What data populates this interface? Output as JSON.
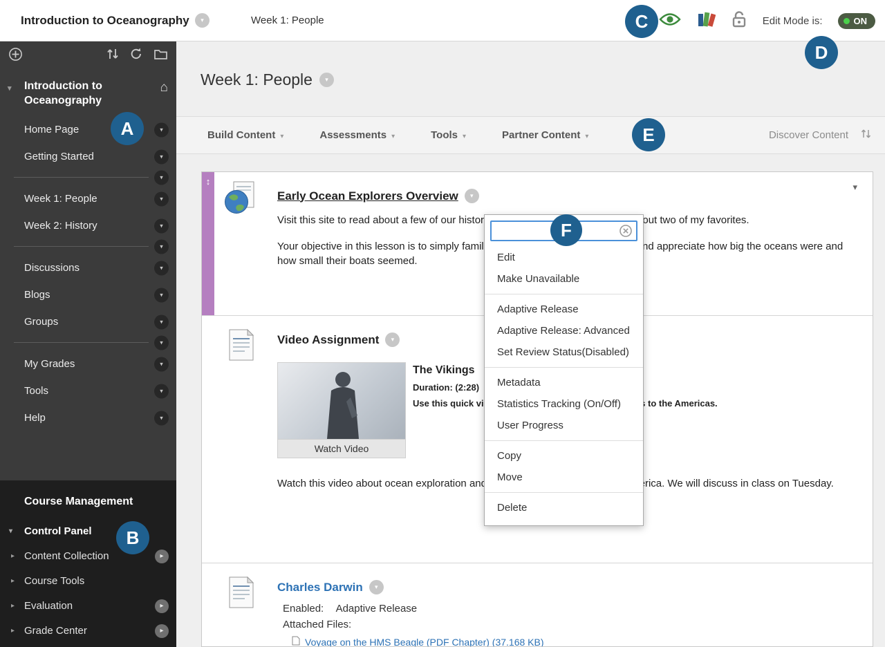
{
  "topbar": {
    "course_title": "Introduction to Oceanography",
    "breadcrumb": "Week 1: People",
    "edit_mode_label": "Edit Mode is:",
    "edit_mode_value": "ON"
  },
  "callouts": {
    "a": "A",
    "b": "B",
    "c": "C",
    "d": "D",
    "e": "E",
    "f": "F"
  },
  "sidebar": {
    "course_name": "Introduction to Oceanography",
    "nav": [
      {
        "label": "Home Page"
      },
      {
        "label": "Getting Started"
      },
      {
        "label": "Week 1: People"
      },
      {
        "label": "Week 2: History"
      },
      {
        "label": "Discussions"
      },
      {
        "label": "Blogs"
      },
      {
        "label": "Groups"
      },
      {
        "label": "My Grades"
      },
      {
        "label": "Tools"
      },
      {
        "label": "Help"
      }
    ],
    "management": {
      "title": "Course Management",
      "control_panel": "Control Panel",
      "items": [
        {
          "label": "Content Collection"
        },
        {
          "label": "Course Tools"
        },
        {
          "label": "Evaluation"
        },
        {
          "label": "Grade Center"
        }
      ]
    }
  },
  "main": {
    "page_title": "Week 1: People",
    "action_bar": {
      "buttons": [
        {
          "label": "Build Content"
        },
        {
          "label": "Assessments"
        },
        {
          "label": "Tools"
        },
        {
          "label": "Partner Content"
        }
      ],
      "discover_label": "Discover Content"
    },
    "items": {
      "explorers": {
        "title": "Early Ocean Explorers Overview",
        "paragraph1": "Visit this site to read about a few of our historical ocean explorers, then learn about two of my favorites.",
        "paragraph2": "Your objective in this lesson is to simply familiarize yourself with their voyages and appreciate how big the oceans were and how small their boats seemed."
      },
      "video": {
        "title": "Video Assignment",
        "video_title": "The Vikings",
        "duration": "Duration: (2:28)",
        "caption": "Use this quick video to learn about the Viking voyages to the Americas.",
        "watch_button": "Watch Video",
        "description": "Watch this video about ocean exploration and the Viking discovery of North America. We will discuss in class on Tuesday."
      },
      "darwin": {
        "title": "Charles Darwin",
        "enabled_label": "Enabled:",
        "enabled_value": "Adaptive Release",
        "attached_label": "Attached Files:",
        "attached_file": "Voyage on the HMS Beagle (PDF Chapter) (37.168 KB)"
      }
    }
  },
  "context_menu": {
    "groups": [
      {
        "items": [
          {
            "label": "Edit"
          },
          {
            "label": "Make Unavailable"
          }
        ]
      },
      {
        "items": [
          {
            "label": "Adaptive Release"
          },
          {
            "label": "Adaptive Release: Advanced"
          },
          {
            "label": "Set Review Status(Disabled)"
          }
        ]
      },
      {
        "items": [
          {
            "label": "Metadata"
          },
          {
            "label": "Statistics Tracking (On/Off)"
          },
          {
            "label": "User Progress"
          }
        ]
      },
      {
        "items": [
          {
            "label": "Copy"
          },
          {
            "label": "Move"
          }
        ]
      },
      {
        "items": [
          {
            "label": "Delete"
          }
        ]
      }
    ]
  },
  "colors": {
    "callout_badge": "#1f608f",
    "item_accent_purple": "#b57fc0",
    "link_blue": "#2d72b5",
    "edit_mode_on_pill": "#4c5b43"
  }
}
